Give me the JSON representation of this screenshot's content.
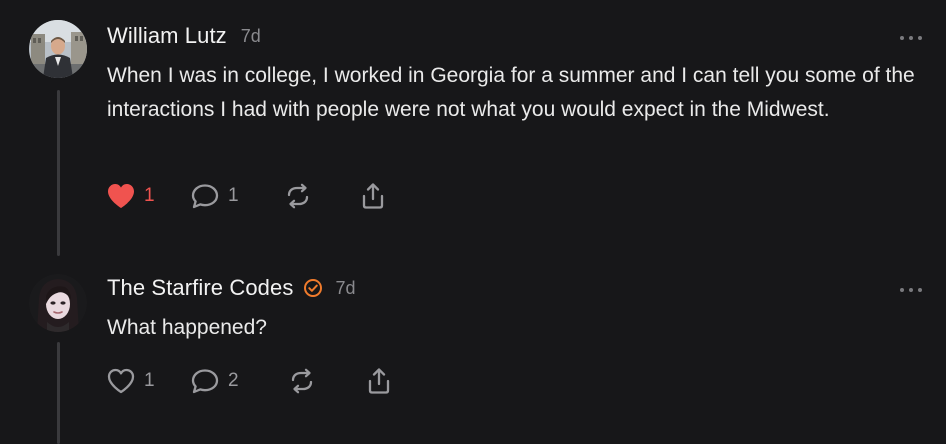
{
  "comments": [
    {
      "author": "William Lutz",
      "timestamp": "7d",
      "verified": false,
      "text": "When I was in college, I worked in Georgia for a summer and I can tell you some of the interactions I had with people were not what you would expect in the Midwest.",
      "likes": "1",
      "liked": true,
      "replies": "1"
    },
    {
      "author": "The Starfire Codes",
      "timestamp": "7d",
      "verified": true,
      "text": "What happened?",
      "likes": "1",
      "liked": false,
      "replies": "2"
    }
  ],
  "colors": {
    "background": "#171719",
    "like_active": "#f0534f",
    "verified_badge": "#f07b2c",
    "muted": "#9a9a9e"
  },
  "icons": [
    "heart-icon",
    "comment-icon",
    "repost-icon",
    "share-icon",
    "more-options-icon",
    "verified-badge-icon"
  ]
}
